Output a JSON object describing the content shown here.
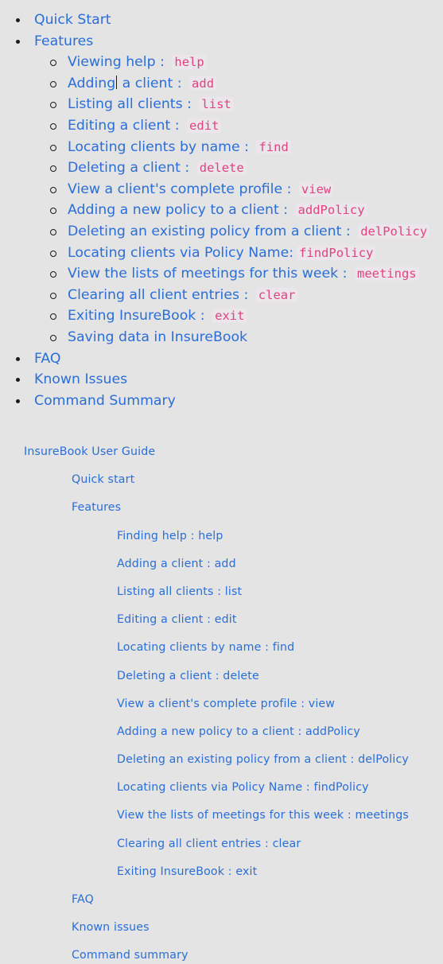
{
  "toc": {
    "items": [
      {
        "label": "Quick Start"
      },
      {
        "label": "Features"
      },
      {
        "label": "FAQ"
      },
      {
        "label": "Known Issues"
      },
      {
        "label": "Command Summary"
      }
    ],
    "features": [
      {
        "label": "Viewing help",
        "command": "help"
      },
      {
        "label_before_caret": "Adding",
        "label_after_caret": " a client",
        "command": "add"
      },
      {
        "label": "Listing all clients",
        "command": "list"
      },
      {
        "label": "Editing a client",
        "command": "edit"
      },
      {
        "label": "Locating clients by name",
        "command": "find"
      },
      {
        "label": "Deleting a client",
        "command": "delete"
      },
      {
        "label": "View a client's complete profile",
        "command": "view"
      },
      {
        "label": "Adding a new policy to a client",
        "command": "addPolicy"
      },
      {
        "label": "Deleting an existing policy from a client",
        "command": "delPolicy"
      },
      {
        "label": "Locating clients via Policy Name:",
        "command": "findPolicy"
      },
      {
        "label": "View the lists of meetings for this week",
        "command": "meetings"
      },
      {
        "label": "Clearing all client entries",
        "command": "clear"
      },
      {
        "label": "Exiting InsureBook",
        "command": "exit"
      },
      {
        "label": "Saving data in InsureBook"
      }
    ],
    "separator": " : "
  },
  "nav": {
    "root": "InsureBook User Guide",
    "quick_start": "Quick start",
    "features": "Features",
    "feature_items": [
      "Finding help : help",
      "Adding a client : add",
      "Listing all clients : list",
      "Editing a client : edit",
      "Locating clients by name : find",
      "Deleting a client : delete",
      "View a client's complete profile : view",
      "Adding a new policy to a client : addPolicy",
      "Deleting an existing policy from a client : delPolicy",
      "Locating clients via Policy Name : findPolicy",
      "View the lists of meetings for this week : meetings",
      "Clearing all client entries : clear",
      "Exiting InsureBook : exit"
    ],
    "faq": "FAQ",
    "known_issues": "Known issues",
    "command_summary": "Command summary"
  },
  "colors": {
    "link": "#2a6ed6",
    "code": "#e2437e",
    "background": "#e4e4e4"
  }
}
